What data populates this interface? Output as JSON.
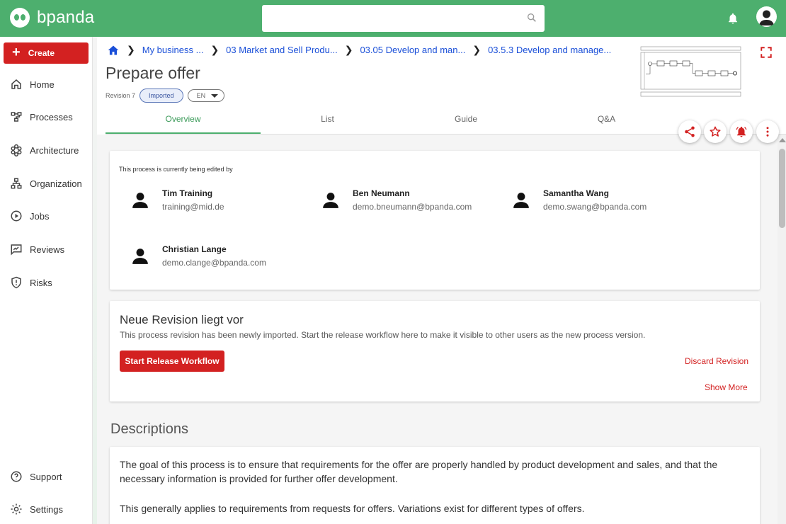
{
  "app": {
    "name": "bpanda"
  },
  "header": {
    "search_placeholder": ""
  },
  "sidebar": {
    "create_label": "Create",
    "items": [
      {
        "label": "Home",
        "icon": "home-icon"
      },
      {
        "label": "Processes",
        "icon": "processes-icon"
      },
      {
        "label": "Architecture",
        "icon": "architecture-icon"
      },
      {
        "label": "Organization",
        "icon": "organization-icon"
      },
      {
        "label": "Jobs",
        "icon": "jobs-icon"
      },
      {
        "label": "Reviews",
        "icon": "reviews-icon"
      },
      {
        "label": "Risks",
        "icon": "risks-icon"
      }
    ],
    "bottom_items": [
      {
        "label": "Support",
        "icon": "help-icon"
      },
      {
        "label": "Settings",
        "icon": "gear-icon"
      }
    ]
  },
  "breadcrumb": [
    "My business ...",
    "03 Market and Sell Produ...",
    "03.05 Develop and man...",
    "03.5.3 Develop and manage..."
  ],
  "page": {
    "title": "Prepare offer",
    "revision": "Revision 7",
    "status_badge": "Imported",
    "language": "EN"
  },
  "tabs": [
    "Overview",
    "List",
    "Guide",
    "Q&A"
  ],
  "active_tab": "Overview",
  "editing": {
    "label": "This process is currently being edited by",
    "editors": [
      {
        "name": "Tim Training",
        "email": "training@mid.de"
      },
      {
        "name": "Ben Neumann",
        "email": "demo.bneumann@bpanda.com"
      },
      {
        "name": "Samantha Wang",
        "email": "demo.swang@bpanda.com"
      },
      {
        "name": "Christian Lange",
        "email": "demo.clange@bpanda.com"
      }
    ]
  },
  "revision_card": {
    "title": "Neue Revision liegt vor",
    "text": "This process revision has been newly imported. Start the release workflow here to make it visible to other users as the new process version.",
    "start_button": "Start Release Workflow",
    "discard_link": "Discard Revision",
    "show_more_link": "Show More"
  },
  "descriptions": {
    "heading": "Descriptions",
    "paragraphs": [
      "The goal of this process is to ensure that requirements for the offer are properly handled by product development and sales, and that the necessary information is provided for further offer development.",
      "This generally applies to requirements from requests for offers. Variations exist for different types of offers."
    ]
  },
  "colors": {
    "brand_green": "#4daf6e",
    "accent_red": "#d32121",
    "link_blue": "#1a4fd8"
  }
}
